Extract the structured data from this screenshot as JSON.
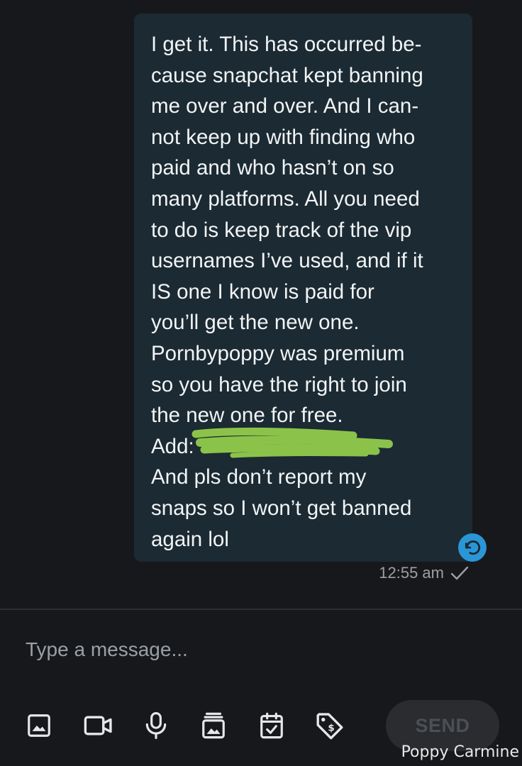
{
  "message": {
    "lines": [
      "I get it. This has occurred be-",
      "cause snapchat kept banning",
      "me over and over. And I can-",
      "not keep up with finding who",
      "paid and who hasn’t on so",
      "many platforms. All you need",
      "to do is keep track of the vip",
      "usernames I’ve used, and if it",
      "IS one I know is paid for",
      "you’ll get the new one.",
      "Pornbypoppy was premium",
      "so you have the right to join",
      "the new one for free.",
      "Add:",
      "And pls don’t report my",
      "snaps so I won’t get banned",
      "again lol"
    ],
    "time": "12:55 am",
    "status_icon": "check-icon",
    "redaction_color": "#8bc34a"
  },
  "composer": {
    "placeholder": "Type a message..."
  },
  "toolbar": {
    "icons": [
      "image-icon",
      "video-icon",
      "microphone-icon",
      "gallery-icon",
      "calendar-check-icon",
      "price-tag-icon"
    ],
    "send_label": "SEND"
  },
  "watermark": "Poppy Carmine",
  "colors": {
    "background": "#17181b",
    "bubble": "#1b2a33",
    "accent": "#2b96d6",
    "icon": "#e6e7e8"
  }
}
